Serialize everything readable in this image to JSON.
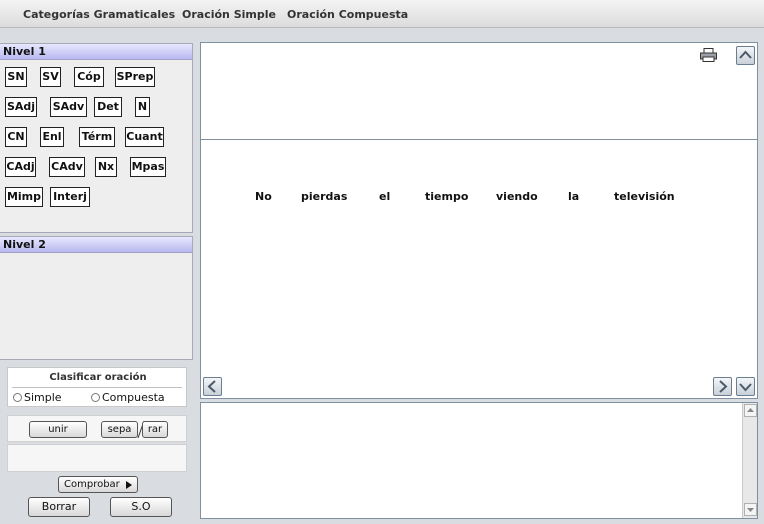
{
  "menu": [
    "Categorías Gramaticales",
    "Oración Simple",
    "Oración Compuesta"
  ],
  "level1": {
    "title": "Nivel 1",
    "categories": [
      "SN",
      "SV",
      "Cóp",
      "SPrep",
      "SAdj",
      "SAdv",
      "Det",
      "N",
      "CN",
      "Enl",
      "Térm",
      "Cuant",
      "CAdj",
      "CAdv",
      "Nx",
      "Mpas",
      "Mimp",
      "Interj"
    ]
  },
  "level2": {
    "title": "Nivel 2"
  },
  "classify": {
    "title": "Clasificar oración",
    "options": [
      "Simple",
      "Compuesta"
    ]
  },
  "buttons": {
    "join": "unir",
    "sep_left": "sepa",
    "sep_right": "rar",
    "check": "Comprobar",
    "clear": "Borrar",
    "so": "S.O"
  },
  "sentence": [
    "No",
    "pierdas",
    "el",
    "tiempo",
    "viendo",
    "la",
    "televisión"
  ],
  "icons": {
    "print": "printer-icon",
    "up": "chevron-up-icon",
    "down": "chevron-down-icon",
    "left": "chevron-left-icon",
    "right": "chevron-right-icon"
  }
}
